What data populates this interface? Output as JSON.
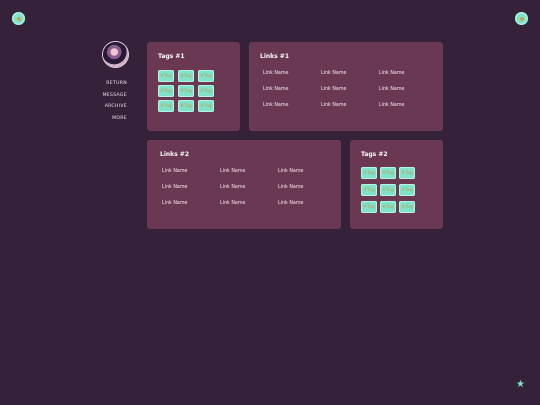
{
  "corner_buttons": {
    "left_icon": "dot-icon",
    "right_icon": "dot-icon"
  },
  "nav": {
    "items": [
      {
        "label": "RETURN"
      },
      {
        "label": "MESSAGE"
      },
      {
        "label": "ARCHIVE"
      },
      {
        "label": "MORE"
      }
    ]
  },
  "tags1": {
    "title": "Tags #1",
    "tags": [
      "#Tag",
      "#Tag",
      "#Tag",
      "#Tag",
      "#Tag",
      "#Tag",
      "#Tag",
      "#Tag",
      "#Tag"
    ]
  },
  "links1": {
    "title": "Links #1",
    "links": [
      "Link Name",
      "Link Name",
      "Link Name",
      "Link Name",
      "Link Name",
      "Link Name",
      "Link Name",
      "Link Name",
      "Link Name"
    ]
  },
  "links2": {
    "title": "Links #2",
    "links": [
      "Link Name",
      "Link Name",
      "Link Name",
      "Link Name",
      "Link Name",
      "Link Name",
      "Link Name",
      "Link Name",
      "Link Name"
    ]
  },
  "tags2": {
    "title": "Tags #2",
    "tags": [
      "#Tag",
      "#Tag",
      "#Tag",
      "#Tag",
      "#Tag",
      "#Tag",
      "#Tag",
      "#Tag",
      "#Tag"
    ]
  },
  "colors": {
    "background": "#35213a",
    "card": "#6a3852",
    "accent": "#7fe3c9",
    "tag_text": "#c29a55"
  },
  "footer": {
    "icon": "star-icon"
  }
}
